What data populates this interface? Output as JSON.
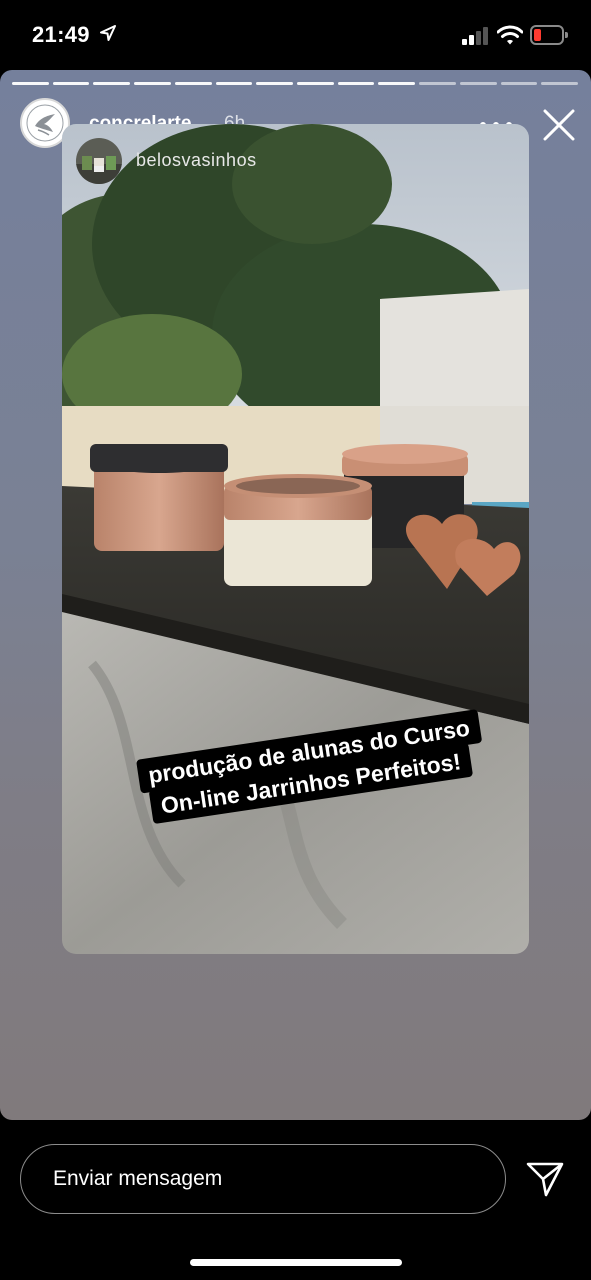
{
  "status_bar": {
    "time": "21:49",
    "signal_bars_active": 2,
    "signal_bars_total": 4,
    "battery_level": 0.15,
    "battery_color": "#ff3b30"
  },
  "story": {
    "segments_total": 14,
    "segments_viewed": 10,
    "account_username": "concrelarte",
    "posted_ago": "6h",
    "more_icon": "more-horizontal-icon",
    "close_icon": "close-icon",
    "mentioned_account": "belosvasinhos",
    "caption_lines": [
      "produção de alunas do Curso",
      "On-line Jarrinhos Perfeitos!"
    ]
  },
  "reply": {
    "placeholder": "Enviar mensagem",
    "send_icon": "send-icon"
  }
}
